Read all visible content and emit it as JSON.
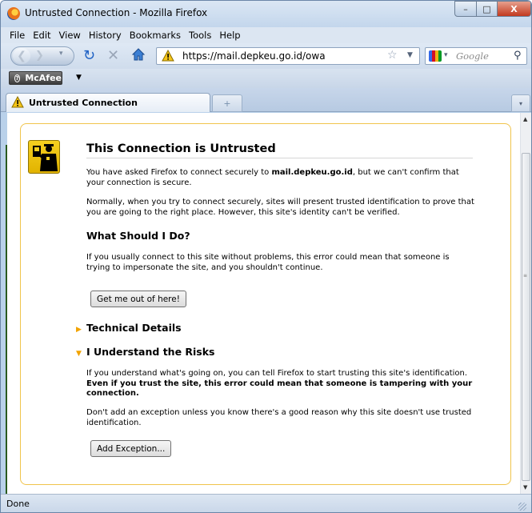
{
  "window": {
    "title": "Untrusted Connection - Mozilla Firefox",
    "controls": {
      "minimize": "–",
      "maximize": "□",
      "close": "X"
    }
  },
  "menu": [
    "File",
    "Edit",
    "View",
    "History",
    "Bookmarks",
    "Tools",
    "Help"
  ],
  "navbar": {
    "url": "https://mail.depkeu.go.id/owa",
    "search_placeholder": "Google",
    "icons": [
      "back-icon",
      "forward-icon",
      "reload-icon",
      "stop-icon",
      "home-icon",
      "warning-icon",
      "bookmark-star-icon",
      "google-icon",
      "search-icon"
    ]
  },
  "mcafee": {
    "label": "McAfee",
    "brand_color": "#3c3c3c"
  },
  "tabs": [
    {
      "label": "Untrusted Connection",
      "icon": "warning-icon"
    }
  ],
  "page": {
    "title": "This Connection is Untrusted",
    "p1_start": "You have asked Firefox to connect securely to ",
    "p1_domain": "mail.depkeu.go.id",
    "p1_end": ", but we can't confirm that your connection is secure.",
    "p2": "Normally, when you try to connect securely, sites will present trusted identification to prove that you are going to the right place. However, this site's identity can't be verified.",
    "what_heading": "What Should I Do?",
    "p3": "If you usually connect to this site without problems, this error could mean that someone is trying to impersonate the site, and you shouldn't continue.",
    "get_out_button": "Get me out of here!",
    "technical_details": "Technical Details",
    "understand_risks": "I Understand the Risks",
    "p4_start": "If you understand what's going on, you can tell Firefox to start trusting this site's identification. ",
    "p4_bold": "Even if you trust the site, this error could mean that someone is tampering with your connection.",
    "p5": "Don't add an exception unless you know there's a good reason why this site doesn't use trusted identification.",
    "add_exception_button": "Add Exception...",
    "accent_border": "#f0c44c",
    "arrow_color": "#f2a300"
  },
  "status": {
    "text": "Done"
  }
}
